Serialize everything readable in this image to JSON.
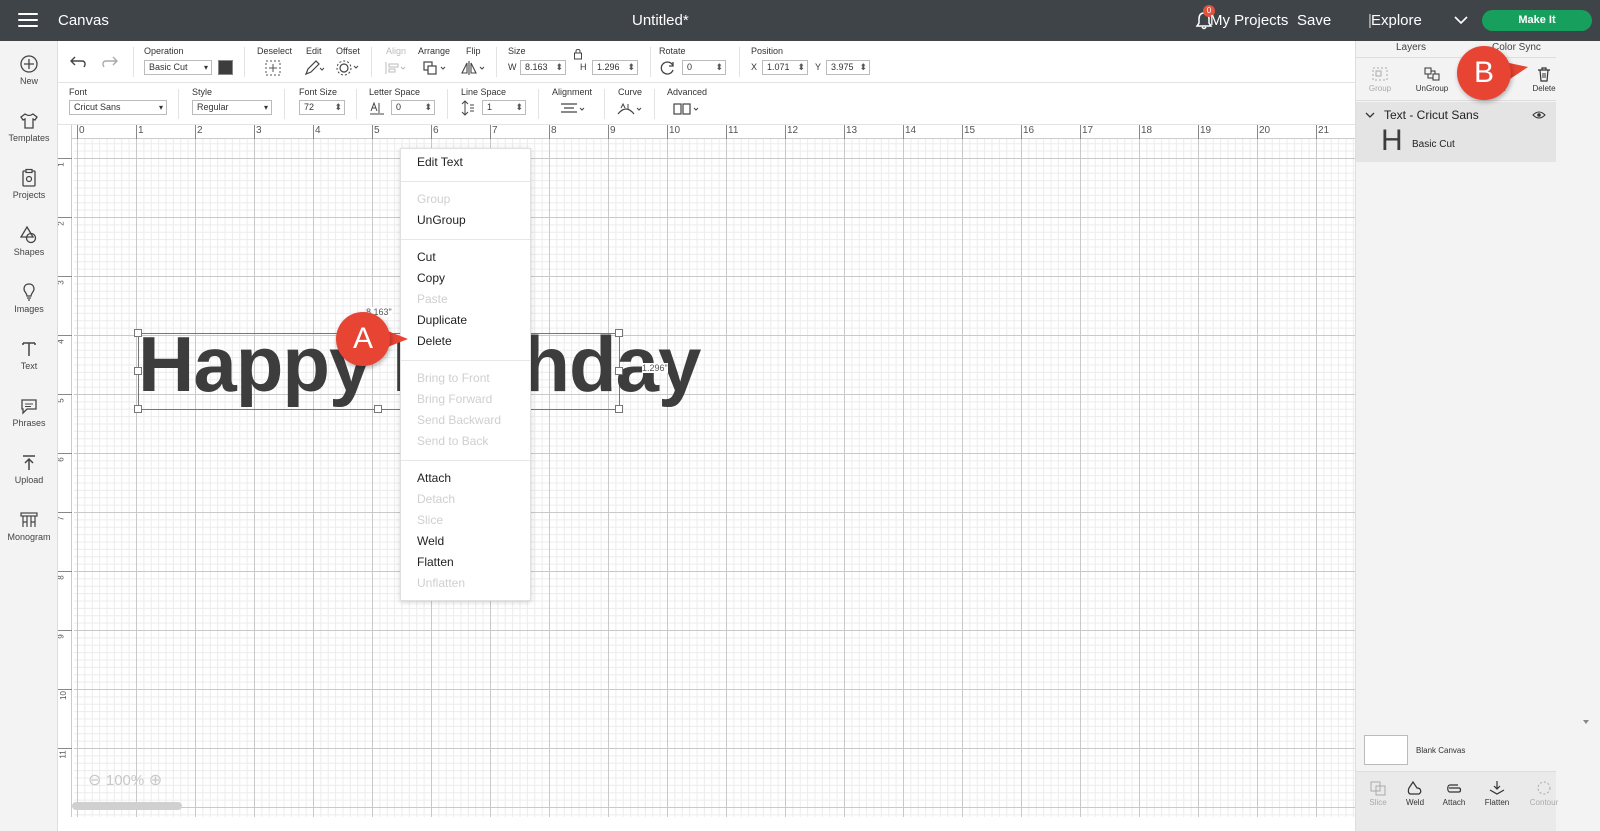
{
  "topbar": {
    "app_title": "Canvas",
    "doc_title": "Untitled*",
    "notification_count": "0",
    "my_projects": "My Projects",
    "save": "Save",
    "separator": "|",
    "explore": "Explore",
    "make_it": "Make It"
  },
  "sidebar": {
    "items": [
      {
        "label": "New",
        "icon": "plus-circle-icon"
      },
      {
        "label": "Templates",
        "icon": "shirt-icon"
      },
      {
        "label": "Projects",
        "icon": "clipboard-icon"
      },
      {
        "label": "Shapes",
        "icon": "shapes-icon"
      },
      {
        "label": "Images",
        "icon": "lightbulb-icon"
      },
      {
        "label": "Text",
        "icon": "text-icon"
      },
      {
        "label": "Phrases",
        "icon": "speech-bubble-icon"
      },
      {
        "label": "Upload",
        "icon": "upload-icon"
      },
      {
        "label": "Monogram",
        "icon": "monogram-icon"
      }
    ]
  },
  "toolbar1": {
    "operation_label": "Operation",
    "operation_value": "Basic Cut",
    "deselect_label": "Deselect",
    "edit_label": "Edit",
    "offset_label": "Offset",
    "align_label": "Align",
    "arrange_label": "Arrange",
    "flip_label": "Flip",
    "size_label": "Size",
    "w_label": "W",
    "w_value": "8.163",
    "h_label": "H",
    "h_value": "1.296",
    "rotate_label": "Rotate",
    "rotate_value": "0",
    "position_label": "Position",
    "x_label": "X",
    "x_value": "1.071",
    "y_label": "Y",
    "y_value": "3.975"
  },
  "toolbar2": {
    "font_label": "Font",
    "font_value": "Cricut Sans",
    "style_label": "Style",
    "style_value": "Regular",
    "font_size_label": "Font Size",
    "font_size_value": "72",
    "letter_space_label": "Letter Space",
    "letter_space_value": "0",
    "line_space_label": "Line Space",
    "line_space_value": "1",
    "alignment_label": "Alignment",
    "curve_label": "Curve",
    "advanced_label": "Advanced"
  },
  "canvas": {
    "ruler_h": [
      "0",
      "1",
      "2",
      "3",
      "4",
      "5",
      "6",
      "7",
      "8",
      "9",
      "10",
      "11",
      "12",
      "13",
      "14",
      "15",
      "16",
      "17",
      "18",
      "19",
      "20",
      "21"
    ],
    "ruler_v": [
      "1",
      "2",
      "3",
      "4",
      "5",
      "6",
      "7",
      "8",
      "9",
      "10",
      "11"
    ],
    "text_object": "Happy Birthday",
    "width_label": "8.163\"",
    "height_label": "1.296\"",
    "zoom": "100%"
  },
  "context_menu": {
    "edit_text": "Edit Text",
    "group": "Group",
    "ungroup": "UnGroup",
    "cut": "Cut",
    "copy": "Copy",
    "paste": "Paste",
    "duplicate": "Duplicate",
    "delete": "Delete",
    "bring_to_front": "Bring to Front",
    "bring_forward": "Bring Forward",
    "send_backward": "Send Backward",
    "send_to_back": "Send to Back",
    "attach": "Attach",
    "detach": "Detach",
    "slice": "Slice",
    "weld": "Weld",
    "flatten": "Flatten",
    "unflatten": "Unflatten"
  },
  "callouts": {
    "a": "A",
    "b": "B"
  },
  "right_panel": {
    "tab_layers": "Layers",
    "tab_color_sync": "Color Sync",
    "tools": {
      "group": "Group",
      "ungroup": "UnGroup",
      "duplicate_partial": "e",
      "delete": "Delete"
    },
    "layer_group_title": "Text - Cricut Sans",
    "layer_child_letter": "H",
    "layer_child_name": "Basic Cut",
    "blank_canvas": "Blank Canvas",
    "bottom_tools": {
      "slice": "Slice",
      "weld": "Weld",
      "attach": "Attach",
      "flatten": "Flatten",
      "contour": "Contour"
    }
  },
  "colors": {
    "topbar_bg": "#3f4448",
    "make_it": "#17a05d",
    "callout": "#e84433",
    "badge": "#e2533f"
  }
}
